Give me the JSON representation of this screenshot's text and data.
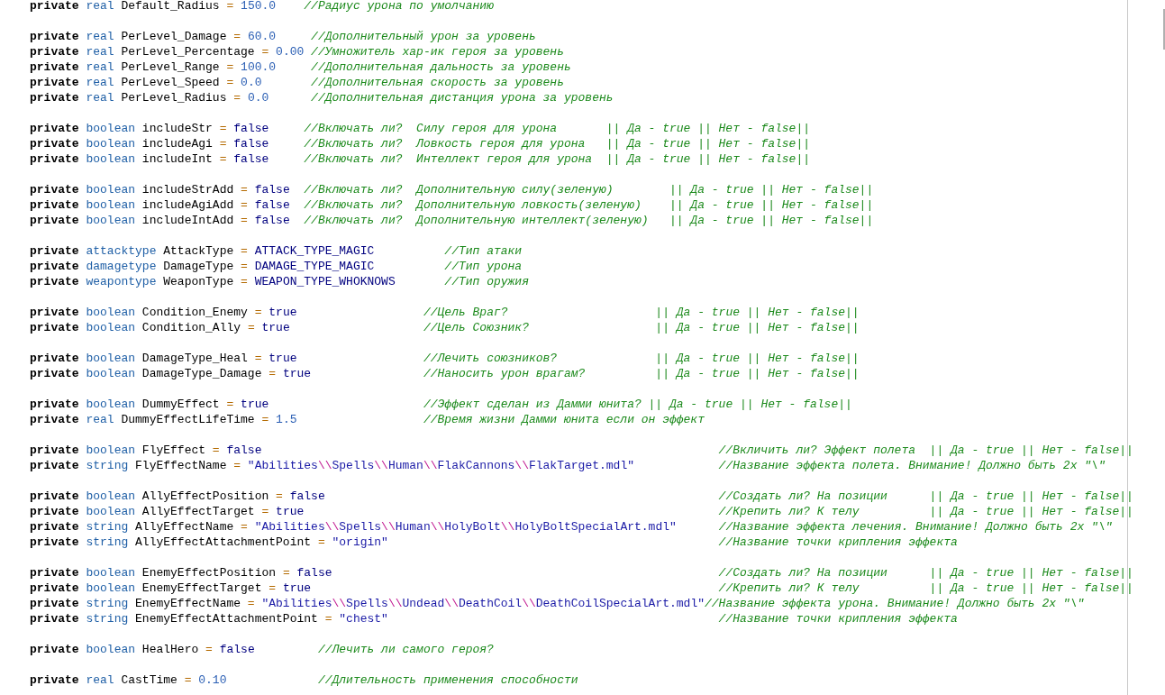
{
  "editor": {
    "blocks": [
      [
        {
          "tokens": [
            {
              "kind": "kw",
              "text": "private "
            },
            {
              "kind": "type",
              "text": "real "
            },
            {
              "kind": "name",
              "text": "Default_Radius "
            },
            {
              "kind": "op",
              "text": "= "
            },
            {
              "kind": "num",
              "text": "150.0    "
            },
            {
              "kind": "comment",
              "text": "//Радиус урона по умолчанию"
            }
          ]
        }
      ],
      [
        {
          "tokens": [
            {
              "kind": "kw",
              "text": "private "
            },
            {
              "kind": "type",
              "text": "real "
            },
            {
              "kind": "name",
              "text": "PerLevel_Damage "
            },
            {
              "kind": "op",
              "text": "= "
            },
            {
              "kind": "num",
              "text": "60.0     "
            },
            {
              "kind": "comment",
              "text": "//Дополнительный урон за уровень"
            }
          ]
        },
        {
          "tokens": [
            {
              "kind": "kw",
              "text": "private "
            },
            {
              "kind": "type",
              "text": "real "
            },
            {
              "kind": "name",
              "text": "PerLevel_Percentage "
            },
            {
              "kind": "op",
              "text": "= "
            },
            {
              "kind": "num",
              "text": "0.00 "
            },
            {
              "kind": "comment",
              "text": "//Умножитель хар-ик героя за уровень"
            }
          ]
        },
        {
          "tokens": [
            {
              "kind": "kw",
              "text": "private "
            },
            {
              "kind": "type",
              "text": "real "
            },
            {
              "kind": "name",
              "text": "PerLevel_Range "
            },
            {
              "kind": "op",
              "text": "= "
            },
            {
              "kind": "num",
              "text": "100.0     "
            },
            {
              "kind": "comment",
              "text": "//Дополнительная дальность за уровень"
            }
          ]
        },
        {
          "tokens": [
            {
              "kind": "kw",
              "text": "private "
            },
            {
              "kind": "type",
              "text": "real "
            },
            {
              "kind": "name",
              "text": "PerLevel_Speed "
            },
            {
              "kind": "op",
              "text": "= "
            },
            {
              "kind": "num",
              "text": "0.0       "
            },
            {
              "kind": "comment",
              "text": "//Дополнительная скорость за уровень"
            }
          ]
        },
        {
          "tokens": [
            {
              "kind": "kw",
              "text": "private "
            },
            {
              "kind": "type",
              "text": "real "
            },
            {
              "kind": "name",
              "text": "PerLevel_Radius "
            },
            {
              "kind": "op",
              "text": "= "
            },
            {
              "kind": "num",
              "text": "0.0      "
            },
            {
              "kind": "comment",
              "text": "//Дополнительная дистанция урона за уровень"
            }
          ]
        }
      ],
      [
        {
          "tokens": [
            {
              "kind": "kw",
              "text": "private "
            },
            {
              "kind": "type",
              "text": "boolean "
            },
            {
              "kind": "name",
              "text": "includeStr "
            },
            {
              "kind": "op",
              "text": "= "
            },
            {
              "kind": "lit",
              "text": "false     "
            },
            {
              "kind": "comment",
              "text": "//Включать ли?  Силу героя для урона       || Да - true || Нет - false||"
            }
          ]
        },
        {
          "tokens": [
            {
              "kind": "kw",
              "text": "private "
            },
            {
              "kind": "type",
              "text": "boolean "
            },
            {
              "kind": "name",
              "text": "includeAgi "
            },
            {
              "kind": "op",
              "text": "= "
            },
            {
              "kind": "lit",
              "text": "false     "
            },
            {
              "kind": "comment",
              "text": "//Включать ли?  Ловкость героя для урона   || Да - true || Нет - false||"
            }
          ]
        },
        {
          "tokens": [
            {
              "kind": "kw",
              "text": "private "
            },
            {
              "kind": "type",
              "text": "boolean "
            },
            {
              "kind": "name",
              "text": "includeInt "
            },
            {
              "kind": "op",
              "text": "= "
            },
            {
              "kind": "lit",
              "text": "false     "
            },
            {
              "kind": "comment",
              "text": "//Включать ли?  Интеллект героя для урона  || Да - true || Нет - false||"
            }
          ]
        }
      ],
      [
        {
          "tokens": [
            {
              "kind": "kw",
              "text": "private "
            },
            {
              "kind": "type",
              "text": "boolean "
            },
            {
              "kind": "name",
              "text": "includeStrAdd "
            },
            {
              "kind": "op",
              "text": "= "
            },
            {
              "kind": "lit",
              "text": "false  "
            },
            {
              "kind": "comment",
              "text": "//Включать ли?  Дополнительную силу(зеленую)        || Да - true || Нет - false||"
            }
          ]
        },
        {
          "tokens": [
            {
              "kind": "kw",
              "text": "private "
            },
            {
              "kind": "type",
              "text": "boolean "
            },
            {
              "kind": "name",
              "text": "includeAgiAdd "
            },
            {
              "kind": "op",
              "text": "= "
            },
            {
              "kind": "lit",
              "text": "false  "
            },
            {
              "kind": "comment",
              "text": "//Включать ли?  Дополнительную ловкость(зеленую)    || Да - true || Нет - false||"
            }
          ]
        },
        {
          "tokens": [
            {
              "kind": "kw",
              "text": "private "
            },
            {
              "kind": "type",
              "text": "boolean "
            },
            {
              "kind": "name",
              "text": "includeIntAdd "
            },
            {
              "kind": "op",
              "text": "= "
            },
            {
              "kind": "lit",
              "text": "false  "
            },
            {
              "kind": "comment",
              "text": "//Включать ли?  Дополнительную интеллект(зеленую)   || Да - true || Нет - false||"
            }
          ]
        }
      ],
      [
        {
          "tokens": [
            {
              "kind": "kw",
              "text": "private "
            },
            {
              "kind": "type",
              "text": "attacktype "
            },
            {
              "kind": "name",
              "text": "AttackType "
            },
            {
              "kind": "op",
              "text": "= "
            },
            {
              "kind": "lit",
              "text": "ATTACK_TYPE_MAGIC          "
            },
            {
              "kind": "comment",
              "text": "//Тип атаки"
            }
          ]
        },
        {
          "tokens": [
            {
              "kind": "kw",
              "text": "private "
            },
            {
              "kind": "type",
              "text": "damagetype "
            },
            {
              "kind": "name",
              "text": "DamageType "
            },
            {
              "kind": "op",
              "text": "= "
            },
            {
              "kind": "lit",
              "text": "DAMAGE_TYPE_MAGIC          "
            },
            {
              "kind": "comment",
              "text": "//Тип урона"
            }
          ]
        },
        {
          "tokens": [
            {
              "kind": "kw",
              "text": "private "
            },
            {
              "kind": "type",
              "text": "weapontype "
            },
            {
              "kind": "name",
              "text": "WeaponType "
            },
            {
              "kind": "op",
              "text": "= "
            },
            {
              "kind": "lit",
              "text": "WEAPON_TYPE_WHOKNOWS       "
            },
            {
              "kind": "comment",
              "text": "//Тип оружия"
            }
          ]
        }
      ],
      [
        {
          "tokens": [
            {
              "kind": "kw",
              "text": "private "
            },
            {
              "kind": "type",
              "text": "boolean "
            },
            {
              "kind": "name",
              "text": "Condition_Enemy "
            },
            {
              "kind": "op",
              "text": "= "
            },
            {
              "kind": "lit",
              "text": "true                  "
            },
            {
              "kind": "comment",
              "text": "//Цель Враг?                     || Да - true || Нет - false||"
            }
          ]
        },
        {
          "tokens": [
            {
              "kind": "kw",
              "text": "private "
            },
            {
              "kind": "type",
              "text": "boolean "
            },
            {
              "kind": "name",
              "text": "Condition_Ally "
            },
            {
              "kind": "op",
              "text": "= "
            },
            {
              "kind": "lit",
              "text": "true                   "
            },
            {
              "kind": "comment",
              "text": "//Цель Союзник?                  || Да - true || Нет - false||"
            }
          ]
        }
      ],
      [
        {
          "tokens": [
            {
              "kind": "kw",
              "text": "private "
            },
            {
              "kind": "type",
              "text": "boolean "
            },
            {
              "kind": "name",
              "text": "DamageType_Heal "
            },
            {
              "kind": "op",
              "text": "= "
            },
            {
              "kind": "lit",
              "text": "true                  "
            },
            {
              "kind": "comment",
              "text": "//Лечить союзников?              || Да - true || Нет - false||"
            }
          ]
        },
        {
          "tokens": [
            {
              "kind": "kw",
              "text": "private "
            },
            {
              "kind": "type",
              "text": "boolean "
            },
            {
              "kind": "name",
              "text": "DamageType_Damage "
            },
            {
              "kind": "op",
              "text": "= "
            },
            {
              "kind": "lit",
              "text": "true                "
            },
            {
              "kind": "comment",
              "text": "//Наносить урон врагам?          || Да - true || Нет - false||"
            }
          ]
        }
      ],
      [
        {
          "tokens": [
            {
              "kind": "kw",
              "text": "private "
            },
            {
              "kind": "type",
              "text": "boolean "
            },
            {
              "kind": "name",
              "text": "DummyEffect "
            },
            {
              "kind": "op",
              "text": "= "
            },
            {
              "kind": "lit",
              "text": "true                      "
            },
            {
              "kind": "comment",
              "text": "//Эффект сделан из Дамми юнита? || Да - true || Нет - false||"
            }
          ]
        },
        {
          "tokens": [
            {
              "kind": "kw",
              "text": "private "
            },
            {
              "kind": "type",
              "text": "real "
            },
            {
              "kind": "name",
              "text": "DummyEffectLifeTime "
            },
            {
              "kind": "op",
              "text": "= "
            },
            {
              "kind": "num",
              "text": "1.5                  "
            },
            {
              "kind": "comment",
              "text": "//Время жизни Дамми юнита если он эффект"
            }
          ]
        }
      ],
      [
        {
          "tokens": [
            {
              "kind": "kw",
              "text": "private "
            },
            {
              "kind": "type",
              "text": "boolean "
            },
            {
              "kind": "name",
              "text": "FlyEffect "
            },
            {
              "kind": "op",
              "text": "= "
            },
            {
              "kind": "lit",
              "text": "false                                                                 "
            },
            {
              "kind": "comment",
              "text": "//Вкличить ли? Эффект полета  || Да - true || Нет - false||"
            }
          ]
        },
        {
          "tokens": [
            {
              "kind": "kw",
              "text": "private "
            },
            {
              "kind": "type",
              "text": "string "
            },
            {
              "kind": "name",
              "text": "FlyEffectName "
            },
            {
              "kind": "op",
              "text": "= "
            },
            {
              "kind": "str",
              "text": "\"Abilities"
            },
            {
              "kind": "esc",
              "text": "\\\\"
            },
            {
              "kind": "str",
              "text": "Spells"
            },
            {
              "kind": "esc",
              "text": "\\\\"
            },
            {
              "kind": "str",
              "text": "Human"
            },
            {
              "kind": "esc",
              "text": "\\\\"
            },
            {
              "kind": "str",
              "text": "FlakCannons"
            },
            {
              "kind": "esc",
              "text": "\\\\"
            },
            {
              "kind": "str",
              "text": "FlakTarget.mdl\"            "
            },
            {
              "kind": "comment",
              "text": "//Название эффекта полета. Внимание! Должно быть 2x \"\\\""
            }
          ]
        }
      ],
      [
        {
          "tokens": [
            {
              "kind": "kw",
              "text": "private "
            },
            {
              "kind": "type",
              "text": "boolean "
            },
            {
              "kind": "name",
              "text": "AllyEffectPosition "
            },
            {
              "kind": "op",
              "text": "= "
            },
            {
              "kind": "lit",
              "text": "false                                                        "
            },
            {
              "kind": "comment",
              "text": "//Создать ли? На позиции      || Да - true || Нет - false||"
            }
          ]
        },
        {
          "tokens": [
            {
              "kind": "kw",
              "text": "private "
            },
            {
              "kind": "type",
              "text": "boolean "
            },
            {
              "kind": "name",
              "text": "AllyEffectTarget "
            },
            {
              "kind": "op",
              "text": "= "
            },
            {
              "kind": "lit",
              "text": "true                                                           "
            },
            {
              "kind": "comment",
              "text": "//Крепить ли? К телу          || Да - true || Нет - false||"
            }
          ]
        },
        {
          "tokens": [
            {
              "kind": "kw",
              "text": "private "
            },
            {
              "kind": "type",
              "text": "string "
            },
            {
              "kind": "name",
              "text": "AllyEffectName "
            },
            {
              "kind": "op",
              "text": "= "
            },
            {
              "kind": "str",
              "text": "\"Abilities"
            },
            {
              "kind": "esc",
              "text": "\\\\"
            },
            {
              "kind": "str",
              "text": "Spells"
            },
            {
              "kind": "esc",
              "text": "\\\\"
            },
            {
              "kind": "str",
              "text": "Human"
            },
            {
              "kind": "esc",
              "text": "\\\\"
            },
            {
              "kind": "str",
              "text": "HolyBolt"
            },
            {
              "kind": "esc",
              "text": "\\\\"
            },
            {
              "kind": "str",
              "text": "HolyBoltSpecialArt.mdl\"      "
            },
            {
              "kind": "comment",
              "text": "//Название эффекта лечения. Внимание! Должно быть 2x \"\\\""
            }
          ]
        },
        {
          "tokens": [
            {
              "kind": "kw",
              "text": "private "
            },
            {
              "kind": "type",
              "text": "string "
            },
            {
              "kind": "name",
              "text": "AllyEffectAttachmentPoint "
            },
            {
              "kind": "op",
              "text": "= "
            },
            {
              "kind": "str",
              "text": "\"origin\"                                               "
            },
            {
              "kind": "comment",
              "text": "//Название точки крипления эффекта"
            }
          ]
        }
      ],
      [
        {
          "tokens": [
            {
              "kind": "kw",
              "text": "private "
            },
            {
              "kind": "type",
              "text": "boolean "
            },
            {
              "kind": "name",
              "text": "EnemyEffectPosition "
            },
            {
              "kind": "op",
              "text": "= "
            },
            {
              "kind": "lit",
              "text": "false                                                       "
            },
            {
              "kind": "comment",
              "text": "//Создать ли? На позиции      || Да - true || Нет - false||"
            }
          ]
        },
        {
          "tokens": [
            {
              "kind": "kw",
              "text": "private "
            },
            {
              "kind": "type",
              "text": "boolean "
            },
            {
              "kind": "name",
              "text": "EnemyEffectTarget "
            },
            {
              "kind": "op",
              "text": "= "
            },
            {
              "kind": "lit",
              "text": "true                                                          "
            },
            {
              "kind": "comment",
              "text": "//Крепить ли? К телу          || Да - true || Нет - false||"
            }
          ]
        },
        {
          "tokens": [
            {
              "kind": "kw",
              "text": "private "
            },
            {
              "kind": "type",
              "text": "string "
            },
            {
              "kind": "name",
              "text": "EnemyEffectName "
            },
            {
              "kind": "op",
              "text": "= "
            },
            {
              "kind": "str",
              "text": "\"Abilities"
            },
            {
              "kind": "esc",
              "text": "\\\\"
            },
            {
              "kind": "str",
              "text": "Spells"
            },
            {
              "kind": "esc",
              "text": "\\\\"
            },
            {
              "kind": "str",
              "text": "Undead"
            },
            {
              "kind": "esc",
              "text": "\\\\"
            },
            {
              "kind": "str",
              "text": "DeathCoil"
            },
            {
              "kind": "esc",
              "text": "\\\\"
            },
            {
              "kind": "str",
              "text": "DeathCoilSpecialArt.mdl\""
            },
            {
              "kind": "comment",
              "text": "//Название эффекта урона. Внимание! Должно быть 2x \"\\\""
            }
          ]
        },
        {
          "tokens": [
            {
              "kind": "kw",
              "text": "private "
            },
            {
              "kind": "type",
              "text": "string "
            },
            {
              "kind": "name",
              "text": "EnemyEffectAttachmentPoint "
            },
            {
              "kind": "op",
              "text": "= "
            },
            {
              "kind": "str",
              "text": "\"chest\"                                               "
            },
            {
              "kind": "comment",
              "text": "//Название точки крипления эффекта"
            }
          ]
        }
      ],
      [
        {
          "tokens": [
            {
              "kind": "kw",
              "text": "private "
            },
            {
              "kind": "type",
              "text": "boolean "
            },
            {
              "kind": "name",
              "text": "HealHero "
            },
            {
              "kind": "op",
              "text": "= "
            },
            {
              "kind": "lit",
              "text": "false         "
            },
            {
              "kind": "comment",
              "text": "//Лечить ли самого героя?"
            }
          ]
        }
      ],
      [
        {
          "tokens": [
            {
              "kind": "kw",
              "text": "private "
            },
            {
              "kind": "type",
              "text": "real "
            },
            {
              "kind": "name",
              "text": "CastTime "
            },
            {
              "kind": "op",
              "text": "= "
            },
            {
              "kind": "num",
              "text": "0.10             "
            },
            {
              "kind": "comment",
              "text": "//Длительность применения способности"
            }
          ]
        }
      ]
    ]
  }
}
